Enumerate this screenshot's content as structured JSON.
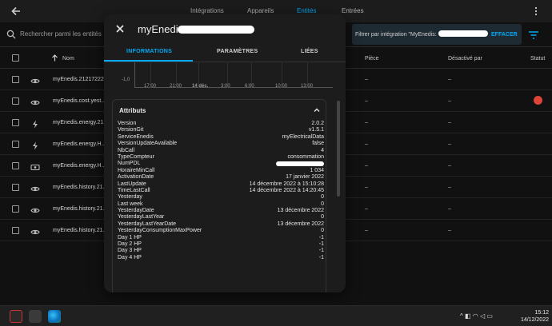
{
  "topbar": {
    "tabs": [
      "Intégrations",
      "Appareils",
      "Entités",
      "Entrées"
    ],
    "active_tab": "Entités"
  },
  "search": {
    "placeholder": "Rechercher parmi les entités"
  },
  "filter": {
    "text": "Filtrer par intégration \"MyEnedis:",
    "clear_label": "EFFACER"
  },
  "table": {
    "headers": {
      "name": "Nom",
      "piece": "Pièce",
      "disabled_by": "Désactivé par",
      "status": "Statut"
    },
    "rows": [
      {
        "name": "myEnedis.21217222...",
        "icon": "eye-icon",
        "piece": "–",
        "disabled": "–",
        "status": ""
      },
      {
        "name": "myEnedis.cost.yest...",
        "icon": "eye-icon",
        "piece": "–",
        "disabled": "–",
        "status": "error"
      },
      {
        "name": "myEnedis.energy.21...",
        "icon": "flash-icon",
        "piece": "–",
        "disabled": "–",
        "status": ""
      },
      {
        "name": "myEnedis.energy.H...",
        "icon": "flash-icon",
        "piece": "–",
        "disabled": "–",
        "status": ""
      },
      {
        "name": "myEnedis.energy.H...",
        "icon": "cash-icon",
        "piece": "–",
        "disabled": "–",
        "status": ""
      },
      {
        "name": "myEnedis.history.21...",
        "icon": "eye-icon",
        "piece": "–",
        "disabled": "–",
        "status": ""
      },
      {
        "name": "myEnedis.history.21...",
        "icon": "eye-icon",
        "piece": "–",
        "disabled": "–",
        "status": ""
      },
      {
        "name": "myEnedis.history.21...",
        "icon": "eye-icon",
        "piece": "–",
        "disabled": "–",
        "status": ""
      }
    ]
  },
  "modal": {
    "title": "myEnedis.",
    "tabs": [
      "INFORMATIONS",
      "PARAMÈTRES",
      "LIÉES"
    ],
    "active_tab": "INFORMATIONS",
    "chart": {
      "ylabel": "-1,0",
      "ticks": [
        "17:00",
        "21:00",
        "14 déc.",
        "3:00",
        "6:00",
        "10:00",
        "13:00"
      ]
    },
    "attributes_title": "Attributs",
    "attributes": [
      {
        "key": "Version",
        "value": "2.0.2"
      },
      {
        "key": "VersionGit",
        "value": "v1.5.1"
      },
      {
        "key": "ServiceEnedis",
        "value": "myElectricalData"
      },
      {
        "key": "VersionUpdateAvailable",
        "value": "false"
      },
      {
        "key": "NbCall",
        "value": "4"
      },
      {
        "key": "TypeCompteur",
        "value": "consommation"
      },
      {
        "key": "NumPDL",
        "value": "",
        "redacted": true
      },
      {
        "key": "HoraireMinCall",
        "value": "1 034"
      },
      {
        "key": "ActivationDate",
        "value": "17 janvier 2022"
      },
      {
        "key": "LastUpdate",
        "value": "14 décembre 2022 à 15:10:28"
      },
      {
        "key": "TimeLastCall",
        "value": "14 décembre 2022 à 14:20:45"
      },
      {
        "key": "Yesterday",
        "value": "0"
      },
      {
        "key": "Last week",
        "value": "0"
      },
      {
        "key": "YesterdayDate",
        "value": "13 décembre 2022"
      },
      {
        "key": "YesterdayLastYear",
        "value": "0"
      },
      {
        "key": "YesterdayLastYearDate",
        "value": "13 décembre 2022"
      },
      {
        "key": "YesterdayConsumptionMaxPower",
        "value": "0"
      },
      {
        "key": "Day 1 HP",
        "value": "-1"
      },
      {
        "key": "Day 2 HP",
        "value": "-1"
      },
      {
        "key": "Day 3 HP",
        "value": "-1"
      },
      {
        "key": "Day 4 HP",
        "value": "-1"
      }
    ]
  },
  "taskbar": {
    "clock_time": "15:12",
    "clock_date": "14/12/2022",
    "tray_symbols": "^ ◧ ◠ ◁ ▭"
  },
  "colors": {
    "accent": "#03a9f4",
    "error": "#db4437",
    "background": "#111111",
    "surface": "#1c1c1c"
  }
}
